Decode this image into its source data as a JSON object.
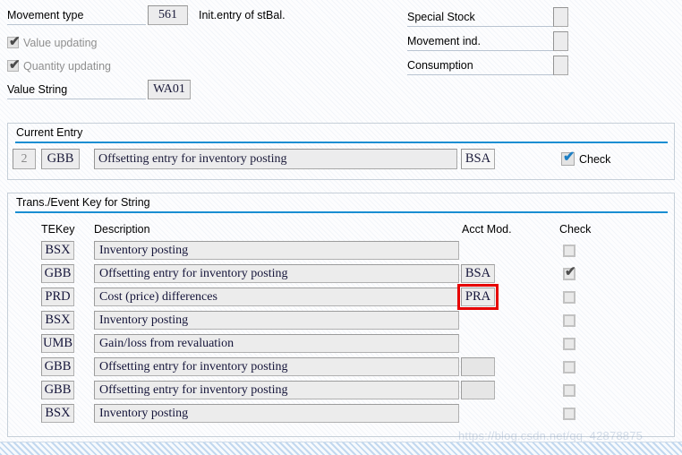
{
  "form": {
    "movement_type": {
      "label": "Movement type",
      "value": "561",
      "description": "Init.entry of stBal."
    },
    "value_updating": {
      "label": "Value updating",
      "checked": true
    },
    "quantity_updating": {
      "label": "Quantity updating",
      "checked": true
    },
    "value_string": {
      "label": "Value String",
      "value": "WA01"
    },
    "special_stock": {
      "label": "Special Stock",
      "value": ""
    },
    "movement_ind": {
      "label": "Movement ind.",
      "value": ""
    },
    "consumption": {
      "label": "Consumption",
      "value": ""
    }
  },
  "current_entry": {
    "title": "Current Entry",
    "counter": "2",
    "tekey": "GBB",
    "description": "Offsetting entry for inventory posting",
    "acct_mod": "BSA",
    "check_label": "Check",
    "checked": true
  },
  "table_panel": {
    "title": "Trans./Event Key for String",
    "columns": {
      "tekey": "TEKey",
      "description": "Description",
      "acct_mod": "Acct Mod.",
      "check": "Check"
    },
    "rows": [
      {
        "tekey": "BSX",
        "description": "Inventory posting",
        "acct_mod": null,
        "has_acct_box": false,
        "checked": false,
        "annotated": false
      },
      {
        "tekey": "GBB",
        "description": "Offsetting entry for inventory posting",
        "acct_mod": "BSA",
        "has_acct_box": true,
        "checked": true,
        "annotated": false
      },
      {
        "tekey": "PRD",
        "description": "Cost (price) differences",
        "acct_mod": "PRA",
        "has_acct_box": true,
        "checked": false,
        "annotated": true
      },
      {
        "tekey": "BSX",
        "description": "Inventory posting",
        "acct_mod": null,
        "has_acct_box": false,
        "checked": false,
        "annotated": false
      },
      {
        "tekey": "UMB",
        "description": "Gain/loss from revaluation",
        "acct_mod": null,
        "has_acct_box": false,
        "checked": false,
        "annotated": false
      },
      {
        "tekey": "GBB",
        "description": "Offsetting entry for inventory posting",
        "acct_mod": "",
        "has_acct_box": true,
        "checked": false,
        "annotated": false
      },
      {
        "tekey": "GBB",
        "description": "Offsetting entry for inventory posting",
        "acct_mod": "",
        "has_acct_box": true,
        "checked": false,
        "annotated": false
      },
      {
        "tekey": "BSX",
        "description": "Inventory posting",
        "acct_mod": null,
        "has_acct_box": false,
        "checked": false,
        "annotated": false
      }
    ]
  },
  "watermark": {
    "text": "https://blog.csdn.net/qq_42878875"
  },
  "colors": {
    "panel_rule": "#1a8ed2",
    "annotation": "#e60000",
    "checkbox_enabled": "#1d7fc4",
    "field_bg": "#ececed"
  },
  "icons": {
    "checkmark": "✔"
  }
}
